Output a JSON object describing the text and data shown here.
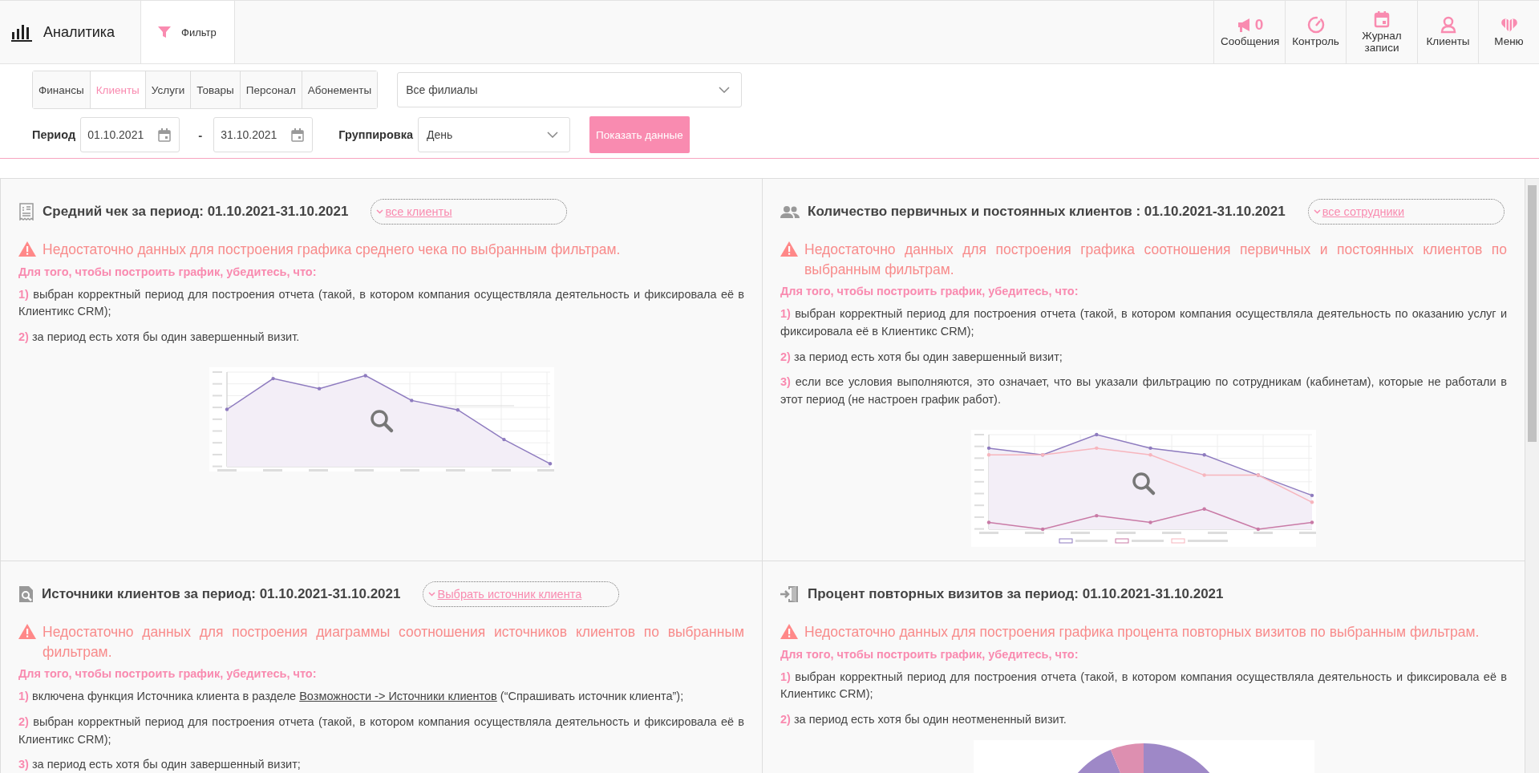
{
  "header": {
    "title": "Аналитика",
    "filter_tab": {
      "label": "Фильтр",
      "selected": true
    },
    "nav": [
      {
        "label": "Сообщения",
        "badge": "0"
      },
      {
        "label": "Контроль"
      },
      {
        "label": "Журнал записи"
      },
      {
        "label": "Клиенты"
      },
      {
        "label": "Меню"
      }
    ]
  },
  "filters": {
    "tabs": [
      {
        "label": "Финансы",
        "selected": false
      },
      {
        "label": "Клиенты",
        "selected": true
      },
      {
        "label": "Услуги",
        "selected": false
      },
      {
        "label": "Товары",
        "selected": false
      },
      {
        "label": "Персонал",
        "selected": false
      },
      {
        "label": "Абонементы",
        "selected": false
      }
    ],
    "branch_select": {
      "value": "Все филиалы"
    },
    "period": {
      "label": "Период",
      "from": "01.10.2021",
      "separator": "-",
      "to": "31.10.2021"
    },
    "grouping": {
      "label": "Группировка",
      "value": "День"
    },
    "submit": "Показать данные"
  },
  "cards": [
    {
      "kind": "average_check",
      "title": "Средний чек за период: 01.10.2021-31.10.2021",
      "filter_link": "все клиенты",
      "warning": "Недостаточно данных для построения графика среднего чека по выбранным фильтрам.",
      "hint": "Для того, чтобы построить график, убедитесь, что:",
      "items": [
        {
          "num": "1)",
          "text": "выбран корректный период для построения отчета (такой, в котором компания осуществляла деятельность и фиксировала её в Клиентикс CRM);"
        },
        {
          "num": "2)",
          "text": "за период есть хотя бы один завершенный визит."
        }
      ]
    },
    {
      "kind": "client_types",
      "title": "Количество первичных и постоянных клиентов : 01.10.2021-31.10.2021",
      "filter_link": "все сотрудники",
      "warning": "Недостаточно данных для построения графика соотношения первичных и постоянных клиентов по выбранным фильтрам.",
      "hint": "Для того, чтобы построить график, убедитесь, что:",
      "items": [
        {
          "num": "1)",
          "text": "выбран корректный период для построения отчета (такой, в котором компания осуществляла деятельность по оказанию услуг и фиксировала её в Клиентикс CRM);"
        },
        {
          "num": "2)",
          "text": "за период есть хотя бы один завершенный визит;"
        },
        {
          "num": "3)",
          "text": "если все условия выполняются, это означает, что вы указали фильтрацию по сотрудникам (кабинетам), которые не работали в этот период (не настроен график работ)."
        }
      ]
    },
    {
      "kind": "sources",
      "title": "Источники клиентов за период: 01.10.2021-31.10.2021",
      "filter_link": "Выбрать источник клиента",
      "warning": "Недостаточно данных для построения диаграммы соотношения источников клиентов по выбранным фильтрам.",
      "hint": "Для того, чтобы построить график, убедитесь, что:",
      "items": [
        {
          "num": "1)",
          "text": "включена функция Источника клиента в разделе ",
          "link": "Возможности -> Источники клиентов",
          "after": " (“Спрашивать источник клиента”);"
        },
        {
          "num": "2)",
          "text": "выбран корректный период для построения отчета (такой, в котором компания осуществляла деятельность и фиксировала её в Клиентикс CRM);"
        },
        {
          "num": "3)",
          "text": "за период есть хотя бы один завершенный визит;"
        }
      ]
    },
    {
      "kind": "repeat_visits",
      "title": "Процент повторных визитов за период: 01.10.2021-31.10.2021",
      "warning": "Недостаточно данных для построения графика процента повторных визитов по выбранным фильтрам.",
      "hint": "Для того, чтобы построить график, убедитесь, что:",
      "items": [
        {
          "num": "1)",
          "text": "выбран корректный период для построения отчета (такой, в котором компания осуществляла деятельность и фиксировала её в Клиентикс CRM);"
        },
        {
          "num": "2)",
          "text": "за период есть хотя бы один неотмененный визит."
        }
      ]
    }
  ]
}
